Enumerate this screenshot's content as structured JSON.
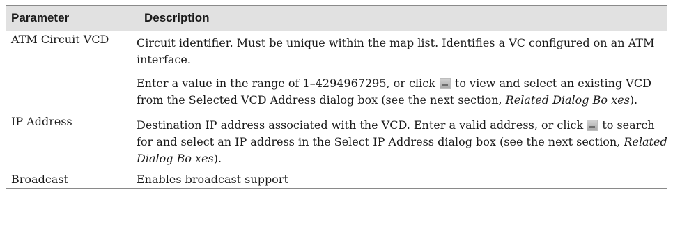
{
  "table": {
    "headers": [
      "Parameter",
      "Description"
    ],
    "rows": [
      {
        "parameter": "ATM Circuit VCD",
        "desc1": "Circuit identifier. Must be unique within the map list. Identifies a VC configured on an ATM interface.",
        "desc2_before_icon": "Enter a value in the range of 1–4294967295, or click",
        "desc2_after_icon": "to view and select an existing VCD from the Selected VCD Address dialog box (see the next section,",
        "desc2_italic": "Related Dialog Bo xes",
        "desc2_end": ")."
      },
      {
        "parameter": "IP Address",
        "desc_before_icon": "Destination IP address associated with the VCD. Enter a valid address, or click",
        "desc_after_icon": "to search for and select an IP address in the Select IP Address dialog box (see the next section,",
        "desc_italic": "Related Dialog Bo xes",
        "desc_end": ")."
      },
      {
        "parameter": "Broadcast",
        "desc": "Enables broadcast support"
      }
    ]
  },
  "icons": {
    "selector_button": "selector-icon"
  }
}
